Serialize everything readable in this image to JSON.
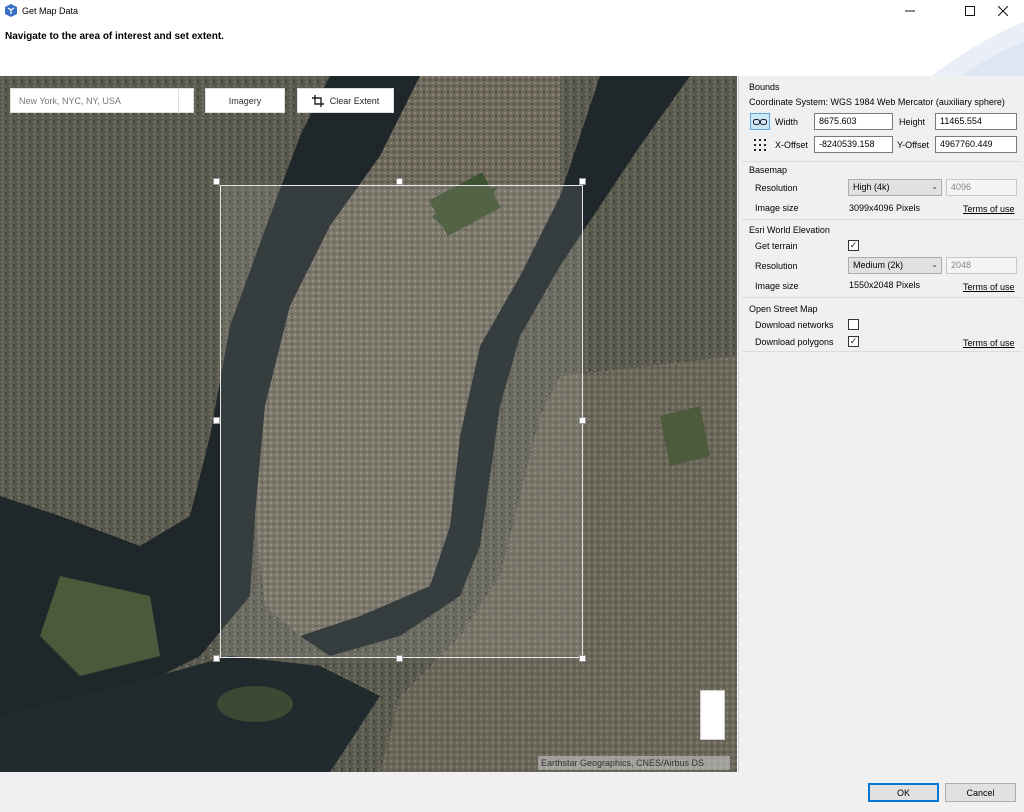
{
  "window": {
    "title": "Get Map Data"
  },
  "header": {
    "instruction": "Navigate to the area of interest and set extent."
  },
  "map": {
    "search": {
      "value": "New York, NYC, NY, USA"
    },
    "imagery_label": "Imagery",
    "clear_extent_label": "Clear Extent",
    "attribution": "Earthstar Geographics, CNES/Airbus DS"
  },
  "bounds": {
    "title": "Bounds",
    "coordinate_system": "Coordinate System: WGS 1984 Web Mercator (auxiliary sphere)",
    "width_label": "Width",
    "width_value": "8675.603",
    "height_label": "Height",
    "height_value": "11465.554",
    "xoffset_label": "X-Offset",
    "xoffset_value": "-8240539.158",
    "yoffset_label": "Y-Offset",
    "yoffset_value": "4967760.449"
  },
  "basemap": {
    "title": "Basemap",
    "resolution_label": "Resolution",
    "resolution_value": "High (4k)",
    "resolution_pixels": "4096",
    "image_size_label": "Image size",
    "image_size_value": "3099x4096 Pixels",
    "terms_label": "Terms of use"
  },
  "elevation": {
    "title": "Esri World Elevation",
    "get_terrain_label": "Get terrain",
    "get_terrain_checked": true,
    "resolution_label": "Resolution",
    "resolution_value": "Medium (2k)",
    "resolution_pixels": "2048",
    "image_size_label": "Image size",
    "image_size_value": "1550x2048 Pixels",
    "terms_label": "Terms of use"
  },
  "osm": {
    "title": "Open Street Map",
    "download_networks_label": "Download networks",
    "download_networks_checked": false,
    "download_polygons_label": "Download polygons",
    "download_polygons_checked": true,
    "terms_label": "Terms of use"
  },
  "footer": {
    "ok_label": "OK",
    "cancel_label": "Cancel"
  },
  "colors": {
    "accent": "#0078d7",
    "map_land": "#55534a",
    "map_water": "#1e2528"
  }
}
